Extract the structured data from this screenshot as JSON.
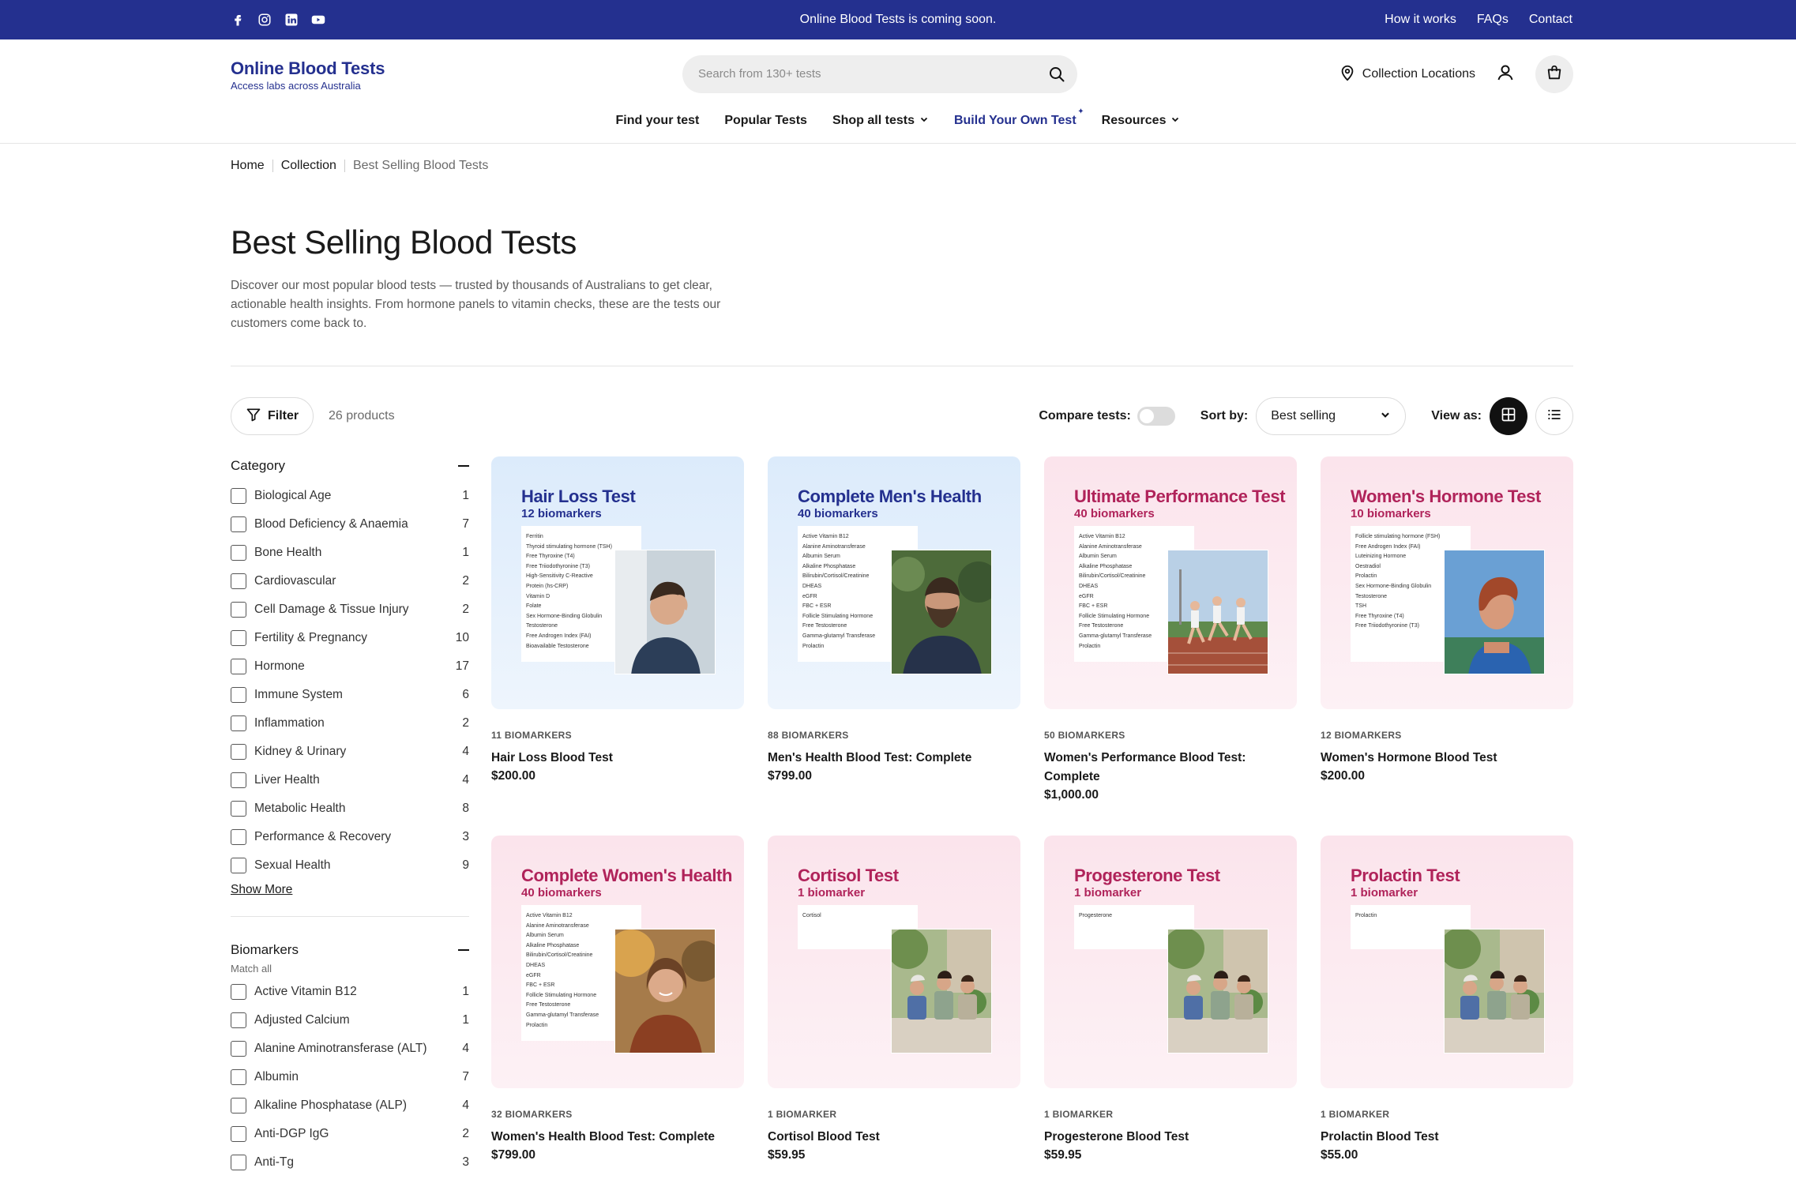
{
  "announcement": {
    "message": "Online Blood Tests is coming soon.",
    "links": [
      "How it works",
      "FAQs",
      "Contact"
    ],
    "social_icons": [
      "facebook-icon",
      "instagram-icon",
      "linkedin-icon",
      "youtube-icon"
    ]
  },
  "header": {
    "logo_title": "Online Blood Tests",
    "logo_tagline": "Access labs across Australia",
    "search_placeholder": "Search from 130+ tests",
    "collection_locations": "Collection Locations",
    "nav": [
      "Find your test",
      "Popular Tests",
      "Shop all tests",
      "Build Your Own Test",
      "Resources"
    ]
  },
  "breadcrumb": [
    "Home",
    "Collection",
    "Best Selling Blood Tests"
  ],
  "page": {
    "title": "Best Selling Blood Tests",
    "description": "Discover our most popular blood tests — trusted by thousands of Australians to get clear, actionable health insights. From hormone panels to vitamin checks, these are the tests our customers come back to."
  },
  "toolbar": {
    "filter_label": "Filter",
    "product_count": "26 products",
    "compare_label": "Compare tests:",
    "sort_label": "Sort by:",
    "sort_value": "Best selling",
    "view_label": "View as:"
  },
  "filters": {
    "category": {
      "title": "Category",
      "items": [
        {
          "label": "Biological Age",
          "count": "1"
        },
        {
          "label": "Blood Deficiency & Anaemia",
          "count": "7"
        },
        {
          "label": "Bone Health",
          "count": "1"
        },
        {
          "label": "Cardiovascular",
          "count": "2"
        },
        {
          "label": "Cell Damage & Tissue Injury",
          "count": "2"
        },
        {
          "label": "Fertility & Pregnancy",
          "count": "10"
        },
        {
          "label": "Hormone",
          "count": "17"
        },
        {
          "label": "Immune System",
          "count": "6"
        },
        {
          "label": "Inflammation",
          "count": "2"
        },
        {
          "label": "Kidney & Urinary",
          "count": "4"
        },
        {
          "label": "Liver Health",
          "count": "4"
        },
        {
          "label": "Metabolic Health",
          "count": "8"
        },
        {
          "label": "Performance & Recovery",
          "count": "3"
        },
        {
          "label": "Sexual Health",
          "count": "9"
        }
      ],
      "show_more": "Show More"
    },
    "biomarkers": {
      "title": "Biomarkers",
      "subtitle": "Match all",
      "items": [
        {
          "label": "Active Vitamin B12",
          "count": "1"
        },
        {
          "label": "Adjusted Calcium",
          "count": "1"
        },
        {
          "label": "Alanine Aminotransferase (ALT)",
          "count": "4"
        },
        {
          "label": "Albumin",
          "count": "7"
        },
        {
          "label": "Alkaline Phosphatase (ALP)",
          "count": "4"
        },
        {
          "label": "Anti-DGP IgG",
          "count": "2"
        },
        {
          "label": "Anti-Tg",
          "count": "3"
        }
      ]
    }
  },
  "products": [
    {
      "theme": "blue",
      "img_title": "Hair Loss Test",
      "img_sub": "12 biomarkers",
      "list": [
        "Ferritin",
        "Thyroid stimulating hormone (TSH)",
        "Free Thyroxine (T4)",
        "Free Triiodothyronine (T3)",
        "High-Sensitivity C-Reactive",
        "Protein (hs-CRP)",
        "Vitamin D",
        "Folate",
        "Sex Hormone-Binding Globulin",
        "Testosterone",
        "Free Androgen Index (FAI)",
        "Bioavailable Testosterone"
      ],
      "photo": "man-touching-hair",
      "biomarkers": "11 BIOMARKERS",
      "name": "Hair Loss Blood Test",
      "price": "$200.00"
    },
    {
      "theme": "blue",
      "img_title": "Complete Men's Health",
      "img_sub": "40 biomarkers",
      "list": [
        "Active Vitamin B12",
        "Alanine Aminotransferase",
        "Albumin Serum",
        "Alkaline Phosphatase",
        "Bilirubin/Cortisol/Creatinine",
        "DHEAS",
        "eGFR",
        "FBC + ESR",
        "Follicle Stimulating Hormone",
        "Free Testosterone",
        "Gamma-glutamyl Transferase",
        "Prolactin"
      ],
      "photo": "bearded-man",
      "biomarkers": "88 BIOMARKERS",
      "name": "Men's Health Blood Test: Complete",
      "price": "$799.00"
    },
    {
      "theme": "pink",
      "img_title": "Ultimate Performance Test",
      "img_sub": "40 biomarkers",
      "list": [
        "Active Vitamin B12",
        "Alanine Aminotransferase",
        "Albumin Serum",
        "Alkaline Phosphatase",
        "Bilirubin/Cortisol/Creatinine",
        "DHEAS",
        "eGFR",
        "FBC + ESR",
        "Follicle Stimulating Hormone",
        "Free Testosterone",
        "Gamma-glutamyl Transferase",
        "Prolactin"
      ],
      "photo": "women-running",
      "biomarkers": "50 BIOMARKERS",
      "name": "Women's Performance Blood Test: Complete",
      "price": "$1,000.00"
    },
    {
      "theme": "pink",
      "img_title": "Women's Hormone Test",
      "img_sub": "10 biomarkers",
      "list": [
        "Follicle stimulating hormone (FSH)",
        "Free Androgen Index (FAI)",
        "Luteinizing Hormone",
        "Oestradiol",
        "Prolactin",
        "Sex Hormone-Binding Globulin",
        "Testosterone",
        "TSH",
        "Free Thyroxine (T4)",
        "Free Triiodothyronine (T3)"
      ],
      "photo": "woman-profile",
      "biomarkers": "12 BIOMARKERS",
      "name": "Women's Hormone Blood Test",
      "price": "$200.00"
    },
    {
      "theme": "pink",
      "img_title": "Complete Women's Health",
      "img_sub": "40 biomarkers",
      "list": [
        "Active Vitamin B12",
        "Alanine Aminotransferase",
        "Albumin Serum",
        "Alkaline Phosphatase",
        "Bilirubin/Cortisol/Creatinine",
        "DHEAS",
        "eGFR",
        "FBC + ESR",
        "Follicle Stimulating Hormone",
        "Free Testosterone",
        "Gamma-glutamyl Transferase",
        "Prolactin"
      ],
      "photo": "smiling-woman",
      "biomarkers": "32 BIOMARKERS",
      "name": "Women's Health Blood Test: Complete",
      "price": "$799.00"
    },
    {
      "theme": "pink",
      "img_title": "Cortisol Test",
      "img_sub": "1 biomarker",
      "list": [
        "Cortisol"
      ],
      "photo": "women-at-table",
      "biomarkers": "1 BIOMARKER",
      "name": "Cortisol Blood Test",
      "price": "$59.95"
    },
    {
      "theme": "pink",
      "img_title": "Progesterone Test",
      "img_sub": "1 biomarker",
      "list": [
        "Progesterone"
      ],
      "photo": "women-at-table",
      "biomarkers": "1 BIOMARKER",
      "name": "Progesterone Blood Test",
      "price": "$59.95"
    },
    {
      "theme": "pink",
      "img_title": "Prolactin Test",
      "img_sub": "1 biomarker",
      "list": [
        "Prolactin"
      ],
      "photo": "women-at-table",
      "biomarkers": "1 BIOMARKER",
      "name": "Prolactin Blood Test",
      "price": "$55.00"
    }
  ]
}
